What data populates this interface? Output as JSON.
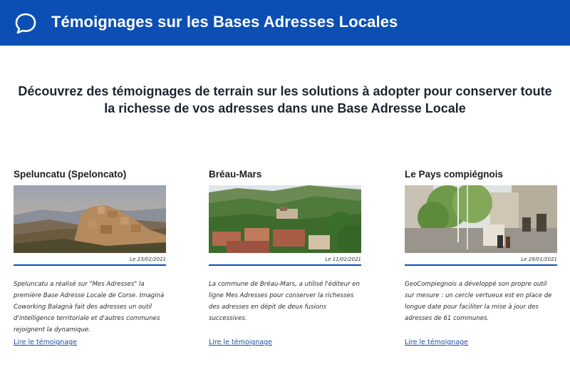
{
  "header": {
    "title": "Témoignages sur les Bases Adresses Locales",
    "icon": "chat-bubble-icon",
    "color": "#0b4fb4"
  },
  "intro": {
    "text": "Découvrez des témoignages de terrain sur les solutions à adopter pour conserver toute la richesse de vos adresses dans une Base Adresse Locale"
  },
  "cards": [
    {
      "name": "Speluncatu (Speloncato)",
      "date": "Le 23/02/2021",
      "description": "Speluncatu a réalisé sur \"Mes Adresses\" la première Base Adresse Locale de Corse. Imaginà Coworking Balagnà fait des adresses un outil d'intelligence territoriale et d'autres communes rejoignent la dynamique.",
      "link": "Lire le témoignage"
    },
    {
      "name": "Bréau-Mars",
      "date": "Le 11/02/2021",
      "description": "La commune de Bréau-Mars, a utilisé l'éditeur en ligne Mes Adresses pour conserver la richesses des adresses en dépit de deux fusions successives.",
      "link": "Lire le témoignage"
    },
    {
      "name": "Le Pays compiégnois",
      "date": "Le 29/01/2021",
      "description": "GeoCompiegnois a développé son propre outil sur mesure : un cercle vertueux est en place de longue date pour faciliter la mise à jour des adresses de 61 communes.",
      "link": "Lire le témoignage"
    }
  ]
}
